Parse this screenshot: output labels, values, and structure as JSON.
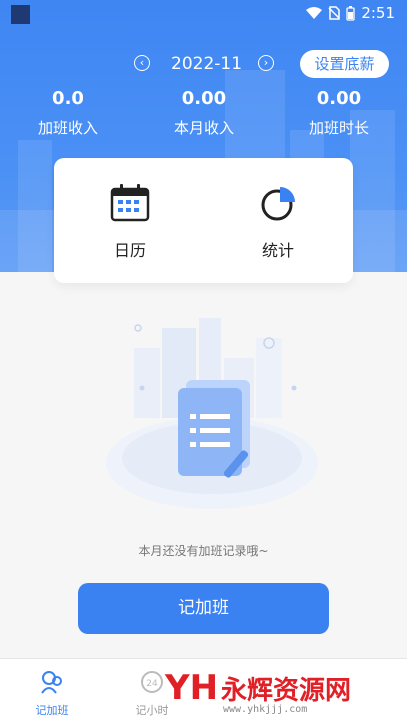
{
  "status_bar": {
    "time": "2:51"
  },
  "header": {
    "month": "2022-11",
    "salary_button": "设置底薪",
    "stats": [
      {
        "value": "0.0",
        "label": "加班收入"
      },
      {
        "value": "0.00",
        "label": "本月收入"
      },
      {
        "value": "0.00",
        "label": "加班时长"
      }
    ]
  },
  "quick_actions": [
    {
      "label": "日历",
      "icon": "calendar-icon"
    },
    {
      "label": "统计",
      "icon": "pie-chart-icon"
    }
  ],
  "empty_state": {
    "message": "本月还没有加班记录哦~"
  },
  "primary_button": "记加班",
  "tabs": [
    {
      "label": "记加班",
      "icon": "people-icon",
      "active": true
    },
    {
      "label": "记小时",
      "icon": "clock-24-icon",
      "active": false
    }
  ],
  "watermark": {
    "title": "永辉资源网",
    "url": "www.yhkjjj.com"
  },
  "colors": {
    "primary": "#3a82f1",
    "header": "#4a90f5",
    "watermark_red": "#e01f26"
  }
}
